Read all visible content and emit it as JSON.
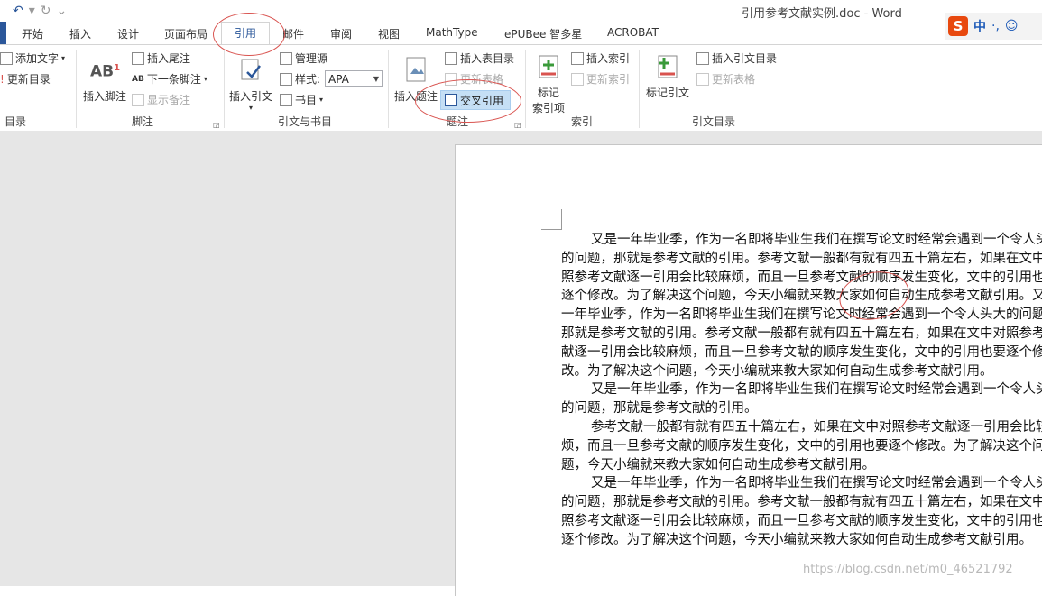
{
  "window": {
    "title": "引用参考文献实例.doc - Word"
  },
  "qat": {
    "undo": "↶",
    "redo": "↻",
    "more": "⌄"
  },
  "ime": {
    "logo": "S",
    "mode": "中",
    "punct": "·,",
    "emoji": "☺"
  },
  "tabs": [
    "开始",
    "插入",
    "设计",
    "页面布局",
    "引用",
    "邮件",
    "审阅",
    "视图",
    "MathType",
    "ePUBee 智多星",
    "ACROBAT"
  ],
  "active_tab": "引用",
  "ribbon": {
    "toc": {
      "add_text": "添加文字",
      "update_toc": "更新目录",
      "group": "目录"
    },
    "footnotes": {
      "insert_footnote": "插入脚注",
      "ab_mark": "AB",
      "insert_endnote": "插入尾注",
      "next_footnote": "下一条脚注",
      "show_notes": "显示备注",
      "group": "脚注"
    },
    "citations": {
      "insert_citation": "插入引文",
      "manage_sources": "管理源",
      "style_label": "样式:",
      "style_value": "APA",
      "bibliography": "书目",
      "group": "引文与书目"
    },
    "captions": {
      "insert_caption": "插入题注",
      "insert_table_of_figures": "插入表目录",
      "update_table": "更新表格",
      "cross_reference": "交叉引用",
      "group": "题注"
    },
    "index": {
      "mark_entry_1": "标记",
      "mark_entry_2": "索引项",
      "insert_index": "插入索引",
      "update_index": "更新索引",
      "group": "索引"
    },
    "toa": {
      "mark_citation": "标记引文",
      "insert_toa": "插入引文目录",
      "update_table": "更新表格",
      "group": "引文目录"
    }
  },
  "document": {
    "paragraphs": [
      "又是一年毕业季，作为一名即将毕业生我们在撰写论文时经常会遇到一个令人头大的问题，那就是参考文献的引用。参考文献一般都有就有四五十篇左右，如果在文中对照参考文献逐一引用会比较麻烦，而且一旦参考文献的顺序发生变化，文中的引用也要逐个修改。为了解决这个问题，今天小编就来教大家如何自动生成参考文献引用。又是一年毕业季，作为一名即将毕业生我们在撰写论文时经常会遇到一个令人头大的问题，那就是参考文献的引用。参考文献一般都有就有四五十篇左右，如果在文中对照参考文献逐一引用会比较麻烦，而且一旦参考文献的顺序发生变化，文中的引用也要逐个修改。为了解决这个问题，今天小编就来教大家如何自动生成参考文献引用。",
      "又是一年毕业季，作为一名即将毕业生我们在撰写论文时经常会遇到一个令人头大的问题，那就是参考文献的引用。",
      "参考文献一般都有就有四五十篇左右，如果在文中对照参考文献逐一引用会比较麻烦，而且一旦参考文献的顺序发生变化，文中的引用也要逐个修改。为了解决这个问题，今天小编就来教大家如何自动生成参考文献引用。",
      "又是一年毕业季，作为一名即将毕业生我们在撰写论文时经常会遇到一个令人头大的问题，那就是参考文献的引用。参考文献一般都有就有四五十篇左右，如果在文中对照参考文献逐一引用会比较麻烦，而且一旦参考文献的顺序发生变化，文中的引用也要逐个修改。为了解决这个问题，今天小编就来教大家如何自动生成参考文献引用。"
    ],
    "watermark": "https://blog.csdn.net/m0_46521792"
  }
}
